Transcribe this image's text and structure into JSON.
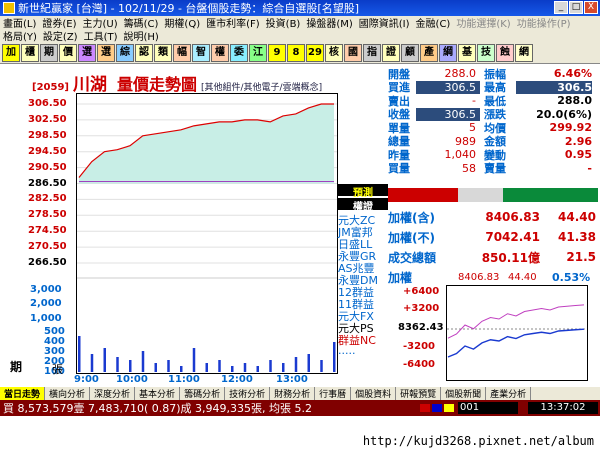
{
  "window": {
    "title": "新世紀贏家 [台灣] - 102/11/29 - 台盤個股走勢：綜合自選股[名望股]",
    "buttons": [
      "_",
      "□",
      "X"
    ]
  },
  "menu1": [
    "畫面(L)",
    "證券(E)",
    "主力(U)",
    "籌碼(C)",
    "期權(Q)",
    "匯市利率(F)",
    "投資(B)",
    "操盤器(M)",
    "國際資訊(I)",
    "金融(C)",
    "功能選擇(K)",
    "功能操作(P)"
  ],
  "menu2": [
    "格局(Y)",
    "設定(Z)",
    "工具(T)",
    "說明(H)"
  ],
  "toolbar": [
    "加",
    "櫃",
    "期",
    "價",
    "選",
    "選",
    "綜",
    "認",
    "類",
    "幅",
    "智",
    "權",
    "委",
    "江",
    "9",
    "8",
    "29",
    "核",
    "國",
    "指",
    "證",
    "顧",
    "產",
    "綱",
    "基",
    "技",
    "蝕",
    "網"
  ],
  "stock": {
    "code": "[2059]",
    "name": "川湖",
    "title": "量價走勢圖",
    "sector": "[其他組件/其他電子/雲端概念]"
  },
  "price_axis": [
    "306.50",
    "302.50",
    "298.50",
    "294.50",
    "290.50",
    "286.50",
    "282.50",
    "278.50",
    "274.50",
    "270.50",
    "266.50"
  ],
  "volume_axis": [
    "3,000",
    "2,000",
    "1,000",
    "500",
    "400",
    "300",
    "200",
    "100"
  ],
  "time_axis": [
    "9:00",
    "10:00",
    "11:00",
    "12:00",
    "13:00"
  ],
  "labels": {
    "period": "期",
    "unit": "張"
  },
  "brokers": {
    "head1": "預測",
    "head2": "權證",
    "items": [
      "元大ZC",
      "JM富邦",
      "日盛LL",
      "永豐GR",
      "AS兆豐",
      "永豐DM",
      "12群益",
      "11群益",
      "元大FX",
      "元大PS",
      "群益NC",
      "....."
    ]
  },
  "quote": [
    {
      "l1": "開盤",
      "v1": "288.0",
      "l2": "振幅",
      "v2": "6.46%"
    },
    {
      "l1": "買進",
      "v1": "306.5",
      "l2": "最高",
      "v2": "306.5"
    },
    {
      "l1": "賣出",
      "v1": "-",
      "l2": "最低",
      "v2": "288.0"
    },
    {
      "l1": "收盤",
      "v1": "306.5",
      "l2": "漲跌",
      "v2": "20.0(6%)"
    },
    {
      "l1": "單量",
      "v1": "5",
      "l2": "均價",
      "v2": "299.92"
    },
    {
      "l1": "總量",
      "v1": "989",
      "l2": "金額",
      "v2": "2.96"
    },
    {
      "l1": "昨量",
      "v1": "1,040",
      "l2": "變動",
      "v2": "0.95"
    },
    {
      "l1": "買量",
      "v1": "58",
      "l2": "賣量",
      "v2": "-"
    }
  ],
  "index": [
    {
      "label": "加權(含)",
      "value": "8406.83",
      "change": "44.40"
    },
    {
      "label": "加權(不)",
      "value": "7042.41",
      "change": "41.38"
    },
    {
      "label": "成交總額",
      "value": "850.11億",
      "change": "21.5"
    }
  ],
  "mini": {
    "label": "加權",
    "value": "8406.83",
    "change": "44.40",
    "pct": "0.53%",
    "axis": [
      "+6400",
      "+3200",
      "8362.43",
      "-3200",
      "-6400"
    ]
  },
  "tabs": [
    "當日走勢",
    "橫向分析",
    "深度分析",
    "基本分析",
    "籌碼分析",
    "技術分析",
    "財務分析",
    "行事曆",
    "個股資料",
    "研報預覽",
    "個股新聞",
    "產業分析"
  ],
  "status": {
    "text": "買 8,573,579壹 7,483,710( 0.87)成 3,949,335張, 均張 5.2",
    "code": "001",
    "clock": "13:37:02"
  },
  "watermark": "http://kujd3268.pixnet.net/album",
  "chart_data": {
    "type": "line",
    "x": [
      "9:00",
      "9:10",
      "9:20",
      "9:30",
      "9:45",
      "10:00",
      "10:15",
      "10:30",
      "10:45",
      "11:00",
      "11:15",
      "11:30",
      "11:45",
      "12:00",
      "12:15",
      "12:30",
      "12:45",
      "13:00",
      "13:10",
      "13:20",
      "13:30"
    ],
    "series": [
      {
        "values": [
          288.0,
          292.0,
          294.5,
          295.0,
          296.0,
          298.5,
          299.0,
          299.5,
          300.0,
          301.0,
          301.5,
          302.0,
          302.0,
          302.5,
          302.5,
          302.0,
          303.5,
          304.0,
          305.5,
          306.5,
          306.5
        ]
      },
      {
        "values": [
          287.0,
          287.0,
          287.0,
          287.0,
          287.0,
          287.0,
          287.0,
          287.0,
          287.0,
          287.0,
          287.0,
          287.0,
          287.0,
          287.0,
          287.0,
          287.0,
          287.0,
          287.0,
          287.0,
          287.0,
          287.0
        ]
      }
    ],
    "volume": [
      60,
      30,
      40,
      25,
      20,
      35,
      15,
      20,
      10,
      40,
      15,
      20,
      10,
      15,
      10,
      20,
      15,
      25,
      30,
      20,
      50
    ],
    "ylim": [
      266.5,
      306.5
    ],
    "reference": 286.5,
    "index_series": [
      8362.43,
      8368,
      8380,
      8375,
      8385,
      8390,
      8388,
      8395,
      8392,
      8398,
      8400,
      8402,
      8400,
      8404,
      8405,
      8406,
      8406.83
    ]
  }
}
